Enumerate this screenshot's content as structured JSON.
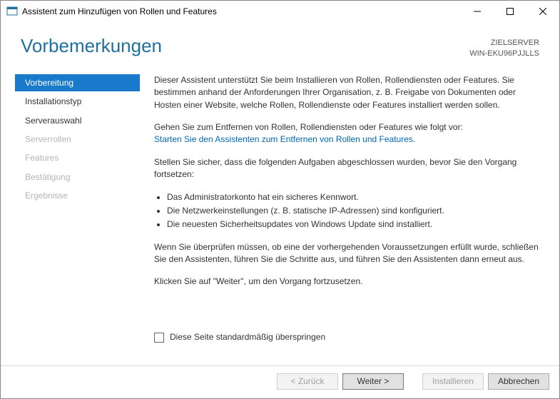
{
  "window": {
    "title": "Assistent zum Hinzufügen von Rollen und Features"
  },
  "header": {
    "heading": "Vorbemerkungen",
    "target_label": "ZIELSERVER",
    "target_server": "WIN-EKU96PJJLLS"
  },
  "nav": {
    "items": [
      {
        "label": "Vorbereitung",
        "state": "selected"
      },
      {
        "label": "Installationstyp",
        "state": "enabled"
      },
      {
        "label": "Serverauswahl",
        "state": "enabled"
      },
      {
        "label": "Serverrollen",
        "state": "disabled"
      },
      {
        "label": "Features",
        "state": "disabled"
      },
      {
        "label": "Bestätigung",
        "state": "disabled"
      },
      {
        "label": "Ergebnisse",
        "state": "disabled"
      }
    ]
  },
  "content": {
    "intro": "Dieser Assistent unterstützt Sie beim Installieren von Rollen, Rollendiensten oder Features. Sie bestimmen anhand der Anforderungen Ihrer Organisation, z. B. Freigabe von Dokumenten oder Hosten einer Website, welche Rollen, Rollendienste oder Features installiert werden sollen.",
    "remove_lead": "Gehen Sie zum Entfernen von Rollen, Rollendiensten oder Features wie folgt vor:",
    "remove_link": "Starten Sie den Assistenten zum Entfernen von Rollen und Features.",
    "prereq_lead": "Stellen Sie sicher, dass die folgenden Aufgaben abgeschlossen wurden, bevor Sie den Vorgang fortsetzen:",
    "bullets": [
      "Das Administratorkonto hat ein sicheres Kennwort.",
      "Die Netzwerkeinstellungen (z. B. statische IP-Adressen) sind konfiguriert.",
      "Die neuesten Sicherheitsupdates von Windows Update sind installiert."
    ],
    "verify": "Wenn Sie überprüfen müssen, ob eine der vorhergehenden Voraussetzungen erfüllt wurde, schließen Sie den Assistenten, führen Sie die Schritte aus, und führen Sie den Assistenten dann erneut aus.",
    "continue": "Klicken Sie auf \"Weiter\", um den Vorgang fortzusetzen.",
    "skip_label": "Diese Seite standardmäßig überspringen",
    "skip_checked": false
  },
  "footer": {
    "back": "< Zurück",
    "next": "Weiter >",
    "install": "Installieren",
    "cancel": "Abbrechen"
  }
}
